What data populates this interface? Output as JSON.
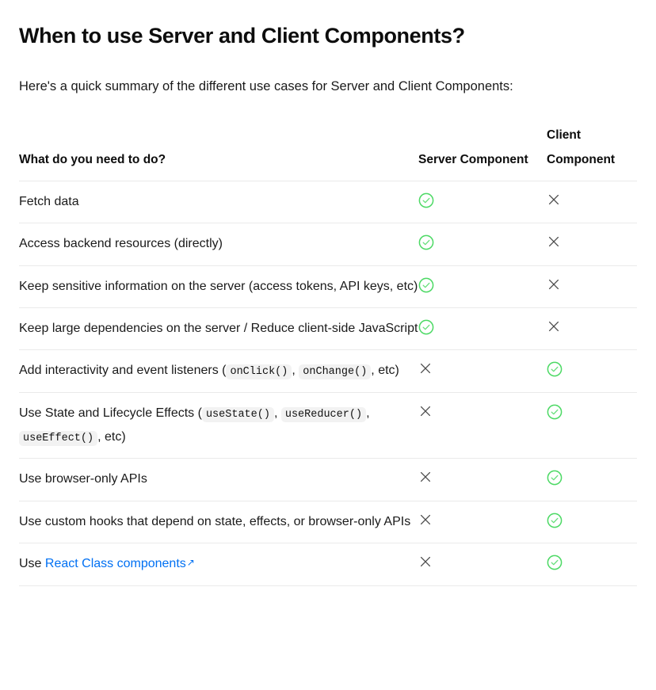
{
  "doc": {
    "title": "When to use Server and Client Components?",
    "intro": "Here's a quick summary of the different use cases for Server and Client Components:"
  },
  "colors": {
    "check_green": "#4cd964",
    "cross_gray": "#4b4b4b",
    "link_blue": "#0070f3",
    "divider": "#eaeaea",
    "code_chip_bg": "#f2f2f2",
    "text": "#1a1a1a"
  },
  "table": {
    "headers": {
      "task": "What do you need to do?",
      "server": "Server Component",
      "client": "Client Component"
    },
    "icons": {
      "yes": "check-circle-icon",
      "no": "cross-icon",
      "external_link": "external-link-arrow-icon"
    },
    "rows": [
      {
        "task_parts": [
          {
            "type": "text",
            "text": "Fetch data"
          }
        ],
        "task_plain": "Fetch data",
        "server": "yes",
        "client": "no"
      },
      {
        "task_parts": [
          {
            "type": "text",
            "text": "Access backend resources (directly)"
          }
        ],
        "task_plain": "Access backend resources (directly)",
        "server": "yes",
        "client": "no"
      },
      {
        "task_parts": [
          {
            "type": "text",
            "text": "Keep sensitive information on the server (access tokens, API keys, etc)"
          }
        ],
        "task_plain": "Keep sensitive information on the server (access tokens, API keys, etc)",
        "server": "yes",
        "client": "no"
      },
      {
        "task_parts": [
          {
            "type": "text",
            "text": "Keep large dependencies on the server / Reduce client-side JavaScript"
          }
        ],
        "task_plain": "Keep large dependencies on the server / Reduce client-side JavaScript",
        "server": "yes",
        "client": "no"
      },
      {
        "task_parts": [
          {
            "type": "text",
            "text": "Add interactivity and event listeners ("
          },
          {
            "type": "code",
            "text": "onClick()"
          },
          {
            "type": "text",
            "text": ", "
          },
          {
            "type": "code",
            "text": "onChange()"
          },
          {
            "type": "text",
            "text": ", etc)"
          }
        ],
        "task_plain": "Add interactivity and event listeners (onClick(), onChange(), etc)",
        "server": "no",
        "client": "yes"
      },
      {
        "task_parts": [
          {
            "type": "text",
            "text": "Use State and Lifecycle Effects ("
          },
          {
            "type": "code",
            "text": "useState()"
          },
          {
            "type": "text",
            "text": ", "
          },
          {
            "type": "code",
            "text": "useReducer()"
          },
          {
            "type": "text",
            "text": ", "
          },
          {
            "type": "code",
            "text": "useEffect()"
          },
          {
            "type": "text",
            "text": ", etc)"
          }
        ],
        "task_plain": "Use State and Lifecycle Effects (useState(), useReducer(), useEffect(), etc)",
        "server": "no",
        "client": "yes"
      },
      {
        "task_parts": [
          {
            "type": "text",
            "text": "Use browser-only APIs"
          }
        ],
        "task_plain": "Use browser-only APIs",
        "server": "no",
        "client": "yes"
      },
      {
        "task_parts": [
          {
            "type": "text",
            "text": "Use custom hooks that depend on state, effects, or browser-only APIs"
          }
        ],
        "task_plain": "Use custom hooks that depend on state, effects, or browser-only APIs",
        "server": "no",
        "client": "yes"
      },
      {
        "task_parts": [
          {
            "type": "text",
            "text": "Use "
          },
          {
            "type": "link",
            "text": "React Class components",
            "external": true
          }
        ],
        "task_plain": "Use React Class components",
        "server": "no",
        "client": "yes"
      }
    ]
  }
}
